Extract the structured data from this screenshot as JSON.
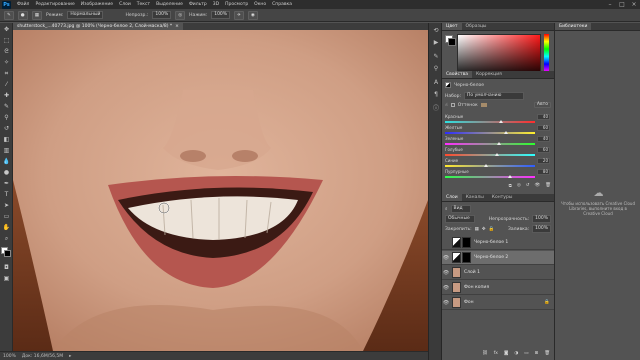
{
  "menubar": {
    "logo": "Ps",
    "items": [
      "Файл",
      "Редактирование",
      "Изображение",
      "Слои",
      "Текст",
      "Выделение",
      "Фильтр",
      "3D",
      "Просмотр",
      "Окно",
      "Справка"
    ]
  },
  "options": {
    "mode_label": "Режим:",
    "mode_value": "Нормальный",
    "opacity_label": "Непрозр.:",
    "opacity_value": "100%",
    "flow_label": "Нажим:",
    "flow_value": "100%"
  },
  "document": {
    "tab_title": "shutterstock_...40773.jpg @ 100% (Черно-белое 2, Слой-маска/8) *",
    "zoom": "100%",
    "doc_info": "Док: 16,6M/56,5M"
  },
  "color_panel": {
    "tabs": [
      "Цвет",
      "Образцы"
    ]
  },
  "properties_panel": {
    "tabs": [
      "Свойства",
      "Коррекция"
    ],
    "title": "Черно-белое",
    "preset_label": "Набор:",
    "preset_value": "По умолчанию",
    "tint_label": "Оттенок",
    "auto_label": "Авто",
    "sliders": [
      {
        "label": "Красные",
        "value": "40",
        "pos": 0.62,
        "grad": [
          "#2ee0e0",
          "#ff2d2d"
        ]
      },
      {
        "label": "Желтые",
        "value": "60",
        "pos": 0.68,
        "grad": [
          "#2d2dff",
          "#ffef2d"
        ]
      },
      {
        "label": "Зеленые",
        "value": "40",
        "pos": 0.6,
        "grad": [
          "#ff2dff",
          "#2dff2d"
        ]
      },
      {
        "label": "Голубые",
        "value": "60",
        "pos": 0.58,
        "grad": [
          "#ff4a2d",
          "#2dffff"
        ]
      },
      {
        "label": "Синие",
        "value": "20",
        "pos": 0.46,
        "grad": [
          "#ffe82d",
          "#2d5cff"
        ]
      },
      {
        "label": "Пурпурные",
        "value": "80",
        "pos": 0.72,
        "grad": [
          "#2dff4a",
          "#ff2dff"
        ]
      }
    ]
  },
  "layers_panel": {
    "tabs": [
      "Слои",
      "Каналы",
      "Контуры"
    ],
    "filter_label": "Вид",
    "blend_mode": "Обычные",
    "opacity_label": "Непрозрачность:",
    "opacity_value": "100%",
    "lock_label": "Закрепить:",
    "fill_label": "Заливка:",
    "fill_value": "100%",
    "layers": [
      {
        "name": "Черно-белое 1",
        "visible": false,
        "selected": false,
        "mask": true
      },
      {
        "name": "Черно-белое 2",
        "visible": true,
        "selected": true,
        "mask": true
      },
      {
        "name": "Слой 1",
        "visible": true,
        "selected": false,
        "mask": false
      },
      {
        "name": "Фон копия",
        "visible": true,
        "selected": false,
        "mask": false
      },
      {
        "name": "Фон",
        "visible": true,
        "selected": false,
        "mask": false
      }
    ]
  },
  "libraries_panel": {
    "title": "Библиотеки",
    "message": "Чтобы использовать Creative Cloud Libraries, выполните вход в Creative Cloud"
  },
  "colors": {
    "panel_bg": "#535353",
    "dark": "#3c3c3c",
    "menubar": "#2d2d2d",
    "selection": "#6d6d6d"
  }
}
